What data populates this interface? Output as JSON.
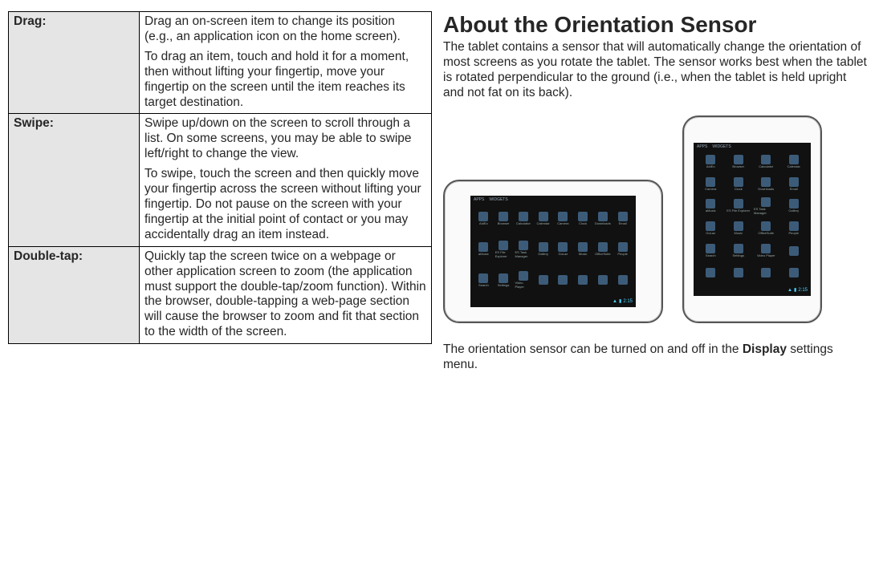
{
  "table": {
    "rows": [
      {
        "term": "Drag:",
        "p1": "Drag an on-screen item to change its position (e.g., an application icon on the home screen).",
        "p2": "To drag an item, touch and hold it for a moment, then without lifting your fingertip, move your fingertip on the screen until the item reaches its target destination."
      },
      {
        "term": "Swipe:",
        "p1": "Swipe up/down on the screen to scroll through a list. On some screens, you may be able to swipe left/right to change the view.",
        "p2": "To swipe, touch the screen and then quickly move your fingertip across the screen without lifting your fingertip. Do not pause on the screen with your fingertip at the initial point of contact or you may accidentally drag an item instead."
      },
      {
        "term": "Double-tap:",
        "p1": "Quickly tap the screen twice on a webpage or other application screen to zoom (the application must support the double-tap/zoom function). Within the browser, double-tapping a web-page section will cause the browser to zoom and fit that section to the width of the screen.",
        "p2": ""
      }
    ]
  },
  "right": {
    "heading": "About the Orientation Sensor",
    "intro": "The tablet contains a sensor that will automatically change the orientation of most screens as you rotate the tablet. The sensor works best when the tablet is rotated perpendicular to the ground (i.e., when the tablet is held upright and not fat on its back).",
    "outro_prefix": "The orientation sensor can be turned on and off in the ",
    "outro_bold": "Display",
    "outro_suffix": " settings menu.",
    "tabs": {
      "a": "APPS",
      "b": "WIDGETS"
    },
    "clock": "2:15",
    "land_apps": [
      "AldEo",
      "Browser",
      "Calculator",
      "Calendar",
      "Camera",
      "Clock",
      "Downloads",
      "Email",
      "aMusic",
      "ES File Explorer",
      "ES Task Manager",
      "Gallery",
      "GoLaz",
      "Music",
      "OfficeSuite",
      "People",
      "Search",
      "Settings",
      "Video Player",
      ""
    ],
    "port_apps": [
      "AldEo",
      "Browser",
      "Calculator",
      "Calendar",
      "Camera",
      "Clock",
      "Downloads",
      "Email",
      "aMusic",
      "ES File Explorer",
      "ES Task Manager",
      "Gallery",
      "GoLaz",
      "Music",
      "OfficeSuite",
      "People",
      "Search",
      "Settings",
      "Video Player",
      ""
    ]
  }
}
